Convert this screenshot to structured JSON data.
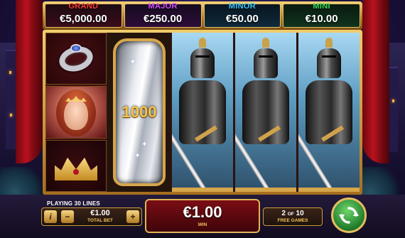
{
  "jackpots": {
    "grand": {
      "name": "GRAND",
      "value": "€5,000.00",
      "color": "#ff3b30"
    },
    "major": {
      "name": "MAJOR",
      "value": "€250.00",
      "color": "#d44cff"
    },
    "minor": {
      "name": "MINOR",
      "value": "€50.00",
      "color": "#38c8ff"
    },
    "mini": {
      "name": "MINI",
      "value": "€10.00",
      "color": "#37e05a"
    }
  },
  "reels": {
    "reel1_symbols": [
      "ring-icon",
      "princess-icon",
      "crown-icon"
    ],
    "shield_value": "1000",
    "knight_reels": 3
  },
  "bottom": {
    "lines_label": "PLAYING 30 LINES",
    "info_glyph": "i",
    "minus_glyph": "−",
    "plus_glyph": "+",
    "bet_amount": "€1.00",
    "bet_label": "TOTAL BET",
    "win_amount": "€1.00",
    "win_label": "WIN",
    "free_current": "2",
    "free_of": "OF",
    "free_total": "10",
    "free_label": "FREE GAMES"
  }
}
